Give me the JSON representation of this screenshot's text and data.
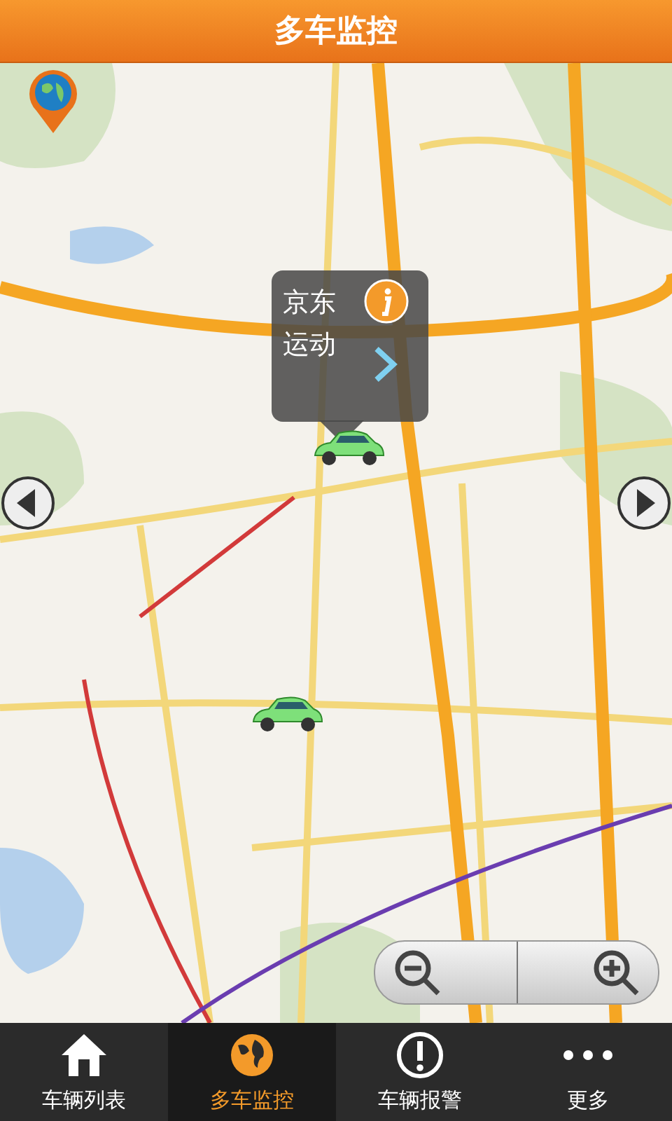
{
  "title_bar": {
    "title": "多车监控"
  },
  "map": {
    "popup": {
      "name": "京东运动"
    },
    "vehicles": [
      {
        "kind": "car"
      },
      {
        "kind": "car"
      }
    ]
  },
  "tabs": [
    {
      "label": "车辆列表",
      "kind": "home",
      "selected": false
    },
    {
      "label": "多车监控",
      "kind": "globe",
      "selected": true
    },
    {
      "label": "车辆报警",
      "kind": "alert",
      "selected": false
    },
    {
      "label": "更多",
      "kind": "more",
      "selected": false
    }
  ]
}
